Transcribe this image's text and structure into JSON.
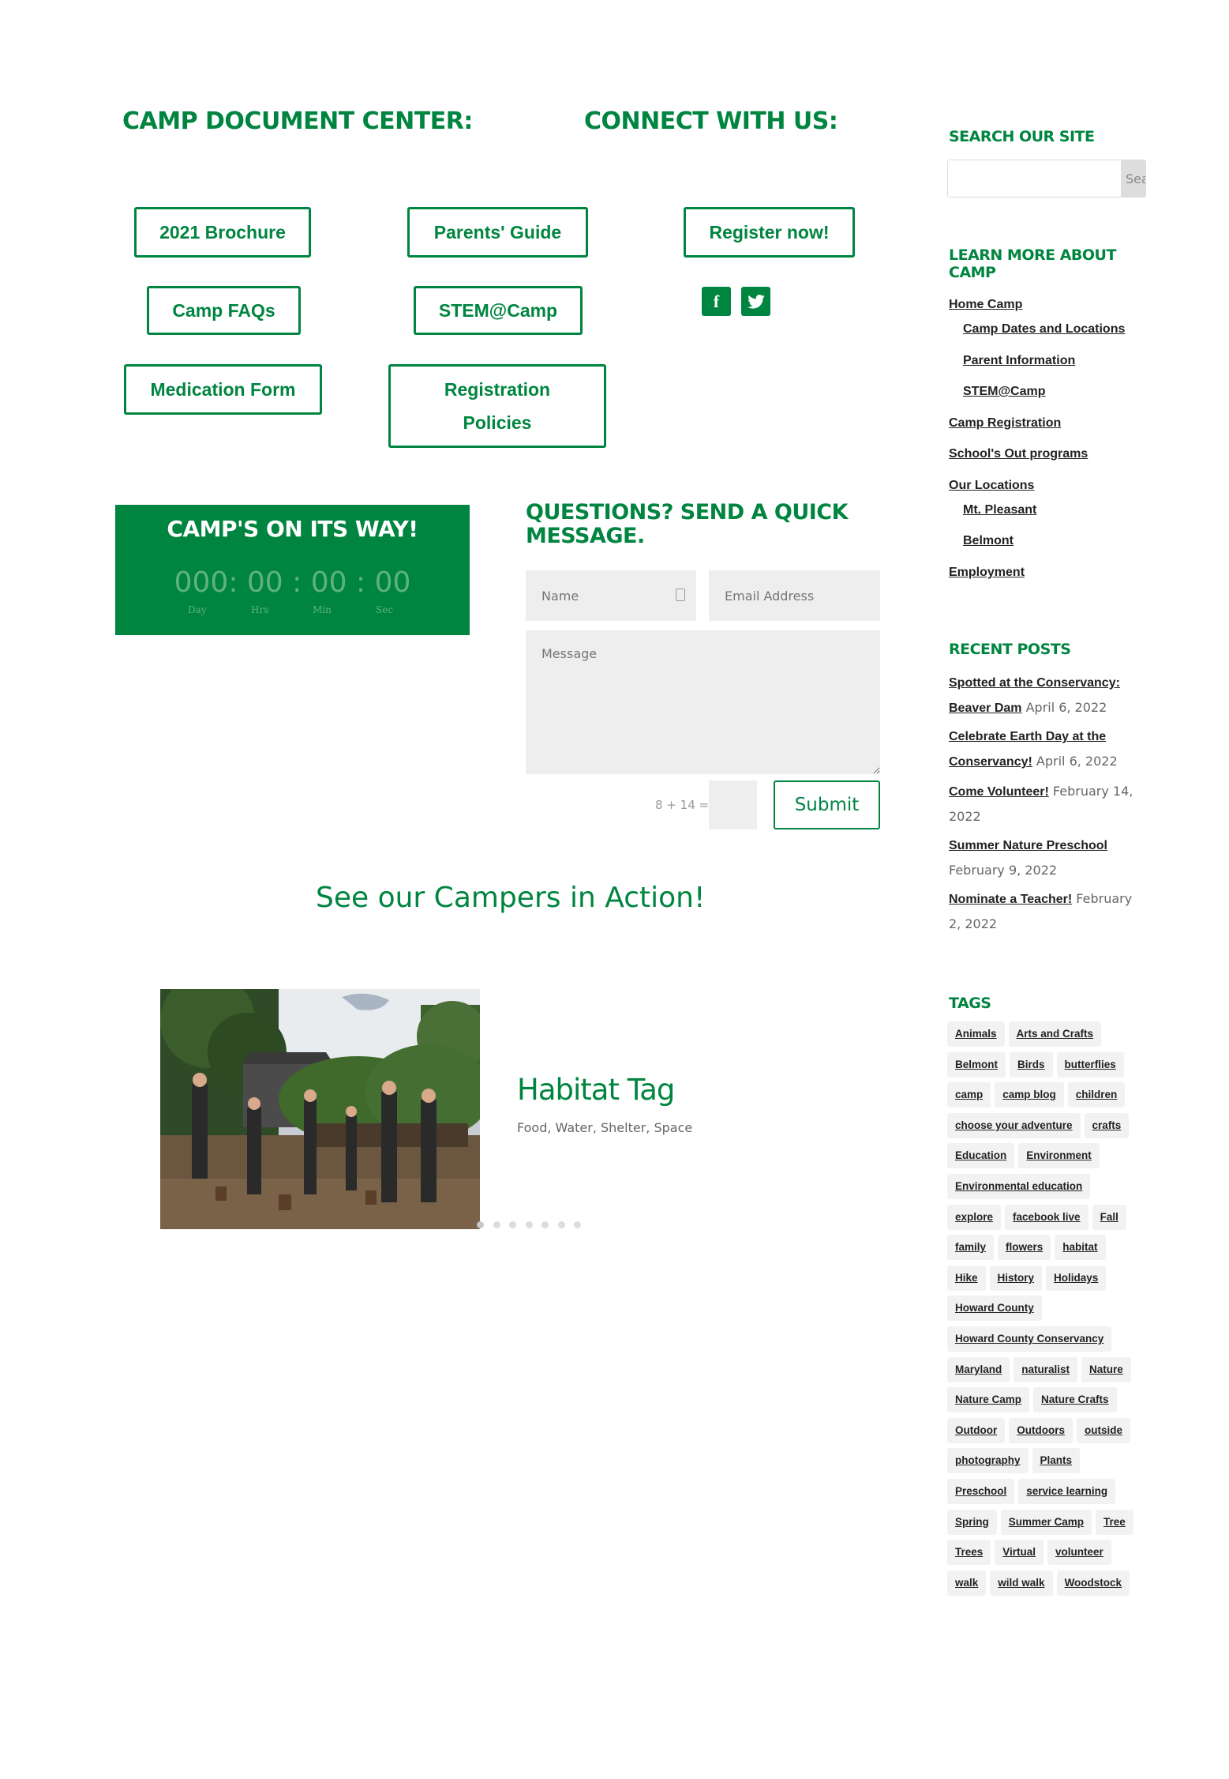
{
  "documents": {
    "heading": "Camp Document Center:",
    "buttons": [
      "2021 Brochure",
      "Parents' Guide",
      "Camp FAQs",
      "STEM@Camp",
      "Medication Form",
      "Registration Policies"
    ]
  },
  "connect": {
    "heading": "Connect With Us:",
    "register_label": "Register now!",
    "social": [
      {
        "icon": "facebook-icon",
        "glyph": "f"
      },
      {
        "icon": "twitter-icon",
        "glyph": "🐦"
      }
    ]
  },
  "countdown": {
    "title": "Camp's on its way!",
    "days": "000",
    "hours": "00",
    "minutes": "00",
    "seconds": "00",
    "labels": [
      "Day",
      "Hrs",
      "Min",
      "Sec"
    ]
  },
  "contact": {
    "heading": "Questions? Send a quick message.",
    "name_placeholder": "Name",
    "email_placeholder": "Email Address",
    "message_placeholder": "Message",
    "captcha_label": "8 + 14 =",
    "captcha_value": "",
    "submit_label": "Submit"
  },
  "slider": {
    "heading": "See our Campers in Action!",
    "slide_title": "Habitat Tag",
    "slide_text": "Food, Water, Shelter, Space",
    "dot_count": 7,
    "active_index": 0
  },
  "sidebar": {
    "search": {
      "heading": "Search our site",
      "value": "",
      "button_label": "Search"
    },
    "learn": {
      "heading": "Learn more about Camp",
      "links": [
        {
          "label": "Home Camp",
          "level": 0
        },
        {
          "label": "Camp Dates and Locations",
          "level": 1
        },
        {
          "label": "Parent Information",
          "level": 1
        },
        {
          "label": "STEM@Camp",
          "level": 1
        },
        {
          "label": "Camp Registration",
          "level": 0
        },
        {
          "label": "School's Out programs",
          "level": 0
        },
        {
          "label": "Our Locations",
          "level": 0
        },
        {
          "label": "Mt. Pleasant",
          "level": 1
        },
        {
          "label": "Belmont",
          "level": 1
        },
        {
          "label": "Employment",
          "level": 0
        }
      ]
    },
    "recent": {
      "heading": "Recent Posts",
      "posts": [
        {
          "title": "Spotted at the Conservancy: Beaver Dam",
          "date": "April 6, 2022"
        },
        {
          "title": "Celebrate Earth Day at the Conservancy!",
          "date": "April 6, 2022"
        },
        {
          "title": "Come Volunteer!",
          "date": "February 14, 2022"
        },
        {
          "title": "Summer Nature Preschool",
          "date": "February 9, 2022"
        },
        {
          "title": "Nominate a Teacher!",
          "date": "February 2, 2022"
        }
      ]
    },
    "tags": {
      "heading": "Tags",
      "rows": [
        [
          "Animals",
          "Arts and Crafts"
        ],
        [
          "Belmont",
          "Birds",
          "butterflies"
        ],
        [
          "camp",
          "camp blog",
          "children"
        ],
        [
          "choose your adventure",
          "crafts"
        ],
        [
          "Education",
          "Environment"
        ],
        [
          "Environmental education"
        ],
        [
          "explore",
          "facebook live",
          "Fall"
        ],
        [
          "family",
          "flowers",
          "habitat"
        ],
        [
          "Hike",
          "History",
          "Holidays"
        ],
        [
          "Howard County"
        ],
        [
          "Howard County Conservancy"
        ],
        [
          "Maryland",
          "naturalist",
          "Nature"
        ],
        [
          "Nature Camp",
          "Nature Crafts"
        ],
        [
          "Outdoor",
          "Outdoors",
          "outside"
        ],
        [
          "photography",
          "Plants"
        ],
        [
          "Preschool",
          "service learning"
        ],
        [
          "Spring",
          "Summer Camp",
          "Tree"
        ],
        [
          "Trees",
          "Virtual",
          "volunteer"
        ],
        [
          "walk",
          "wild walk",
          "Woodstock"
        ]
      ]
    }
  },
  "colors": {
    "brand_green": "#008540",
    "field_bg": "#eeeeee",
    "tag_bg": "#f2f2f2"
  }
}
